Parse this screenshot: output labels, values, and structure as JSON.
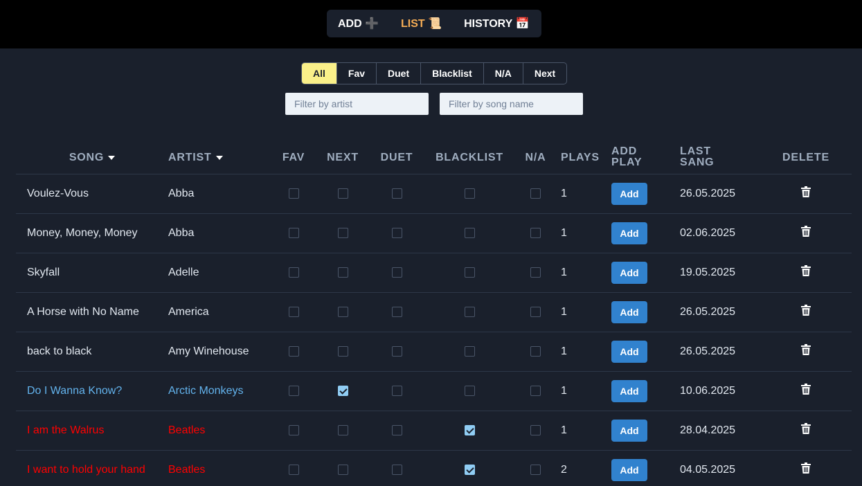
{
  "nav": {
    "add": "ADD ➕",
    "list": "LIST 📜",
    "history": "HISTORY 📅"
  },
  "filters": [
    "All",
    "Fav",
    "Duet",
    "Blacklist",
    "N/A",
    "Next"
  ],
  "active_filter": "All",
  "search": {
    "artist_placeholder": "Filter by artist",
    "artist_value": "",
    "song_placeholder": "Filter by song name",
    "song_value": ""
  },
  "columns": {
    "song": "SONG",
    "artist": "ARTIST",
    "fav": "FAV",
    "next": "NEXT",
    "duet": "DUET",
    "blacklist": "BLACKLIST",
    "na": "N/A",
    "plays": "PLAYS",
    "add_play_1": "ADD",
    "add_play_2": "PLAY",
    "last_sang_1": "LAST",
    "last_sang_2": "SANG",
    "delete": "DELETE"
  },
  "add_label": "Add",
  "colors": {
    "next_row": "#63b3ed",
    "blacklist_row": "#ff0000",
    "active_nav": "#f6ad55",
    "active_filter": "#faf089",
    "add_button": "#3182ce"
  },
  "rows": [
    {
      "song": "Voulez-Vous",
      "artist": "Abba",
      "fav": false,
      "next": false,
      "duet": false,
      "blacklist": false,
      "na": false,
      "plays": "1",
      "last_sang": "26.05.2025"
    },
    {
      "song": "Money, Money, Money",
      "artist": "Abba",
      "fav": false,
      "next": false,
      "duet": false,
      "blacklist": false,
      "na": false,
      "plays": "1",
      "last_sang": "02.06.2025"
    },
    {
      "song": "Skyfall",
      "artist": "Adelle",
      "fav": false,
      "next": false,
      "duet": false,
      "blacklist": false,
      "na": false,
      "plays": "1",
      "last_sang": "19.05.2025"
    },
    {
      "song": "A Horse with No Name",
      "artist": "America",
      "fav": false,
      "next": false,
      "duet": false,
      "blacklist": false,
      "na": false,
      "plays": "1",
      "last_sang": "26.05.2025"
    },
    {
      "song": "back to black",
      "artist": "Amy Winehouse",
      "fav": false,
      "next": false,
      "duet": false,
      "blacklist": false,
      "na": false,
      "plays": "1",
      "last_sang": "26.05.2025"
    },
    {
      "song": "Do I Wanna Know?",
      "artist": "Arctic Monkeys",
      "fav": false,
      "next": true,
      "duet": false,
      "blacklist": false,
      "na": false,
      "plays": "1",
      "last_sang": "10.06.2025"
    },
    {
      "song": "I am the Walrus",
      "artist": "Beatles",
      "fav": false,
      "next": false,
      "duet": false,
      "blacklist": true,
      "na": false,
      "plays": "1",
      "last_sang": "28.04.2025"
    },
    {
      "song": "I want to hold your hand",
      "artist": "Beatles",
      "fav": false,
      "next": false,
      "duet": false,
      "blacklist": true,
      "na": false,
      "plays": "2",
      "last_sang": "04.05.2025"
    }
  ]
}
